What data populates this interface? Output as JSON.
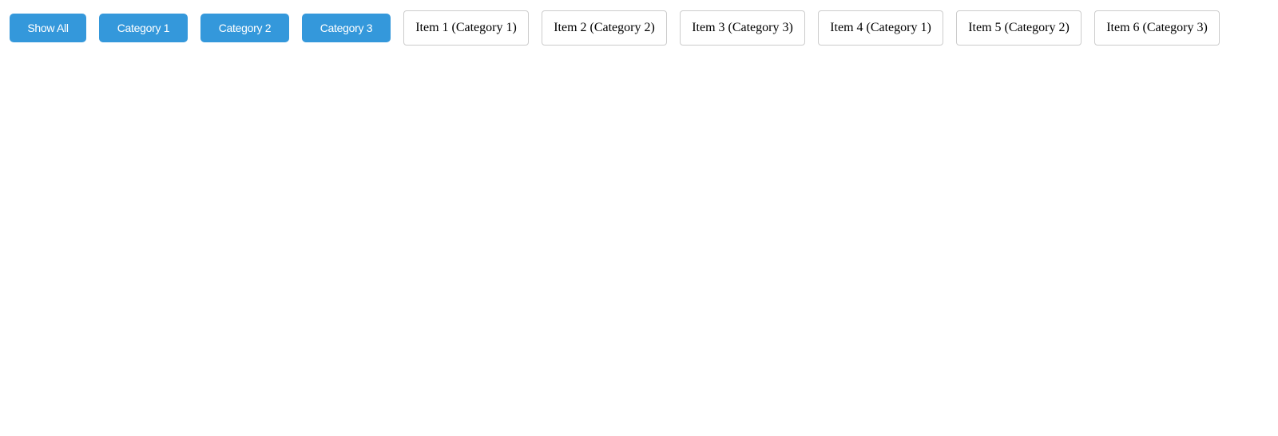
{
  "filters": {
    "show_all_label": "Show All",
    "categories": [
      "Category 1",
      "Category 2",
      "Category 3"
    ],
    "accent_color": "#3498db"
  },
  "items": [
    "Item 1 (Category 1)",
    "Item 2 (Category 2)",
    "Item 3 (Category 3)",
    "Item 4 (Category 1)",
    "Item 5 (Category 2)",
    "Item 6 (Category 3)"
  ]
}
